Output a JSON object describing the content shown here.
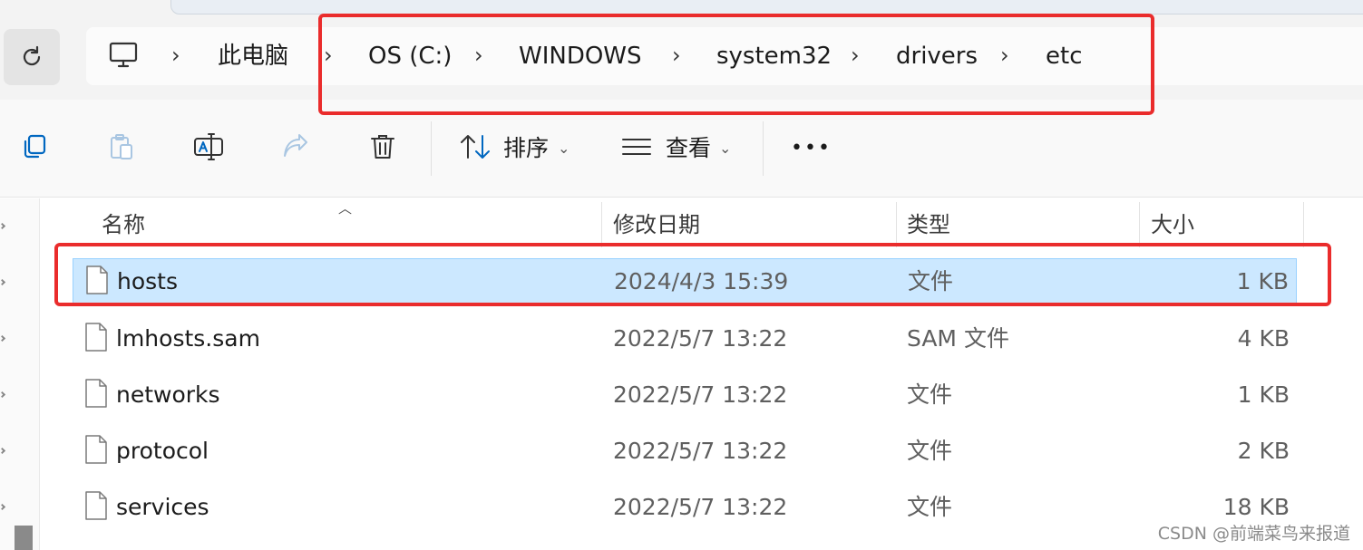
{
  "breadcrumb": {
    "items": [
      "此电脑",
      "OS (C:)",
      "WINDOWS",
      "system32",
      "drivers",
      "etc"
    ]
  },
  "toolbar": {
    "sort_label": "排序",
    "view_label": "查看",
    "more_label": "•••"
  },
  "columns": {
    "name": "名称",
    "modified": "修改日期",
    "type": "类型",
    "size": "大小"
  },
  "files": [
    {
      "name": "hosts",
      "modified": "2024/4/3 15:39",
      "type": "文件",
      "size": "1 KB",
      "selected": true
    },
    {
      "name": "lmhosts.sam",
      "modified": "2022/5/7 13:22",
      "type": "SAM 文件",
      "size": "4 KB",
      "selected": false
    },
    {
      "name": "networks",
      "modified": "2022/5/7 13:22",
      "type": "文件",
      "size": "1 KB",
      "selected": false
    },
    {
      "name": "protocol",
      "modified": "2022/5/7 13:22",
      "type": "文件",
      "size": "2 KB",
      "selected": false
    },
    {
      "name": "services",
      "modified": "2022/5/7 13:22",
      "type": "文件",
      "size": "18 KB",
      "selected": false
    }
  ],
  "watermark": "CSDN @前端菜鸟来报道",
  "colors": {
    "selection_bg": "#cce8ff",
    "annotation_red": "#ea2c2c",
    "accent_blue": "#0067c0"
  },
  "icons": [
    "refresh-icon",
    "this-pc-icon",
    "copy-icon",
    "paste-icon",
    "rename-icon",
    "share-icon",
    "delete-icon",
    "sort-icon",
    "view-icon",
    "file-icon"
  ]
}
